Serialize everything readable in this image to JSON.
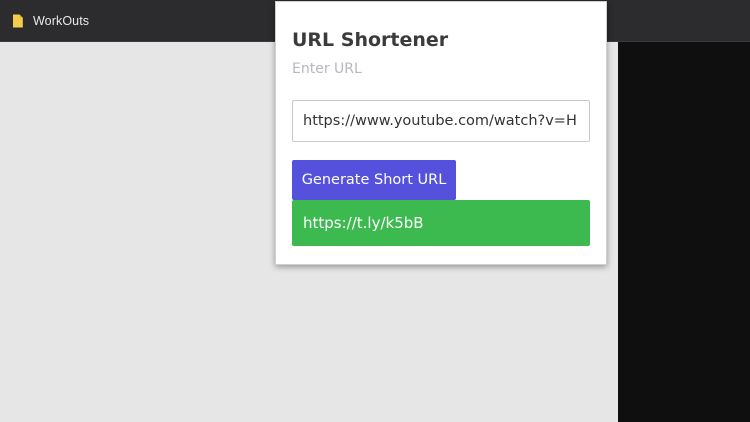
{
  "browser": {
    "bookmarks": [
      {
        "label": "WorkOuts",
        "icon": "folder-icon",
        "icon_color": "#f5cd4c"
      }
    ],
    "content_background": "#e6e6e6",
    "right_panel_background": "#0f0f0f"
  },
  "popup": {
    "title": "URL Shortener",
    "subtitle": "Enter URL",
    "url_input_value": "https://www.youtube.com/watch?v=H",
    "generate_button_label": "Generate Short URL",
    "short_url": "https://t.ly/k5bB",
    "colors": {
      "button": "#5551dc",
      "result": "#3cba4f"
    }
  }
}
